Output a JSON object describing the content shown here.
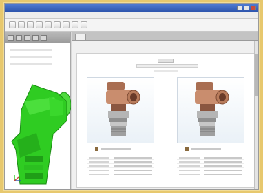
{
  "colors": {
    "background_accent": "#e7c86e",
    "model_green": "#2fcc22",
    "titlebar_blue": "#2d55ad",
    "part_copper": "#b87b5b",
    "part_steel": "#8f8f8f"
  },
  "window": {
    "title": ""
  },
  "menubar": {
    "items": [
      "",
      "",
      "",
      "",
      "",
      "",
      ""
    ]
  },
  "toolbar": {
    "button_count": 9
  },
  "left_panel": {
    "header_icons": [
      "view-icon",
      "tree-icon",
      "filter-icon",
      "layers-icon",
      "settings-icon"
    ],
    "model_description": "green 3D elbow fitting model"
  },
  "content": {
    "heading": "",
    "sheet": {
      "title": "",
      "subtitle": "",
      "panels": [
        {
          "image": "elbow-fitting-part-1",
          "open_label": "",
          "properties": [
            {
              "key": "",
              "value": ""
            },
            {
              "key": "",
              "value": ""
            },
            {
              "key": "",
              "value": ""
            },
            {
              "key": "",
              "value": ""
            },
            {
              "key": "",
              "value": ""
            }
          ]
        },
        {
          "image": "elbow-fitting-part-2",
          "open_label": "",
          "properties": [
            {
              "key": "",
              "value": ""
            },
            {
              "key": "",
              "value": ""
            },
            {
              "key": "",
              "value": ""
            },
            {
              "key": "",
              "value": ""
            },
            {
              "key": "",
              "value": ""
            }
          ]
        }
      ]
    }
  }
}
